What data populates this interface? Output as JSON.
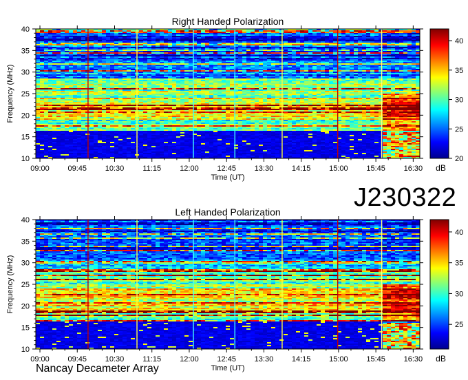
{
  "designation": "J230322",
  "credit": "Nancay Decameter Array",
  "colors": {
    "colormap": [
      "#00008f",
      "#0000ff",
      "#007fff",
      "#00ffff",
      "#7fff7f",
      "#ffff00",
      "#ff7f00",
      "#ff0000",
      "#7f0000"
    ]
  },
  "chart_data": [
    {
      "type": "heatmap",
      "title": "Right Handed Polarization",
      "xlabel": "Time (UT)",
      "ylabel": "Frequency (MHz)",
      "colorbar_label": "dB",
      "x_ticks": [
        "09:00",
        "09:45",
        "10:30",
        "11:15",
        "12:00",
        "12:45",
        "13:30",
        "14:15",
        "15:00",
        "15:45",
        "16:30"
      ],
      "y_ticks": [
        "10",
        "15",
        "20",
        "25",
        "30",
        "35",
        "40"
      ],
      "colorbar_ticks": [
        "20",
        "25",
        "30",
        "35",
        "40"
      ],
      "ylim": [
        10,
        40
      ],
      "zlim": [
        20,
        42
      ],
      "time_range": [
        "08:55",
        "16:38"
      ]
    },
    {
      "type": "heatmap",
      "title": "Left Handed Polarization",
      "xlabel": "Time (UT)",
      "ylabel": "Frequency (MHz)",
      "colorbar_label": "dB",
      "x_ticks": [
        "09:00",
        "09:45",
        "10:30",
        "11:15",
        "12:00",
        "12:45",
        "13:30",
        "14:15",
        "15:00",
        "15:45",
        "16:30"
      ],
      "y_ticks": [
        "10",
        "15",
        "20",
        "25",
        "30",
        "35",
        "40"
      ],
      "colorbar_ticks": [
        "25",
        "30",
        "35",
        "40"
      ],
      "ylim": [
        10,
        40
      ],
      "zlim": [
        21,
        42
      ],
      "time_range": [
        "08:55",
        "16:38"
      ]
    }
  ]
}
